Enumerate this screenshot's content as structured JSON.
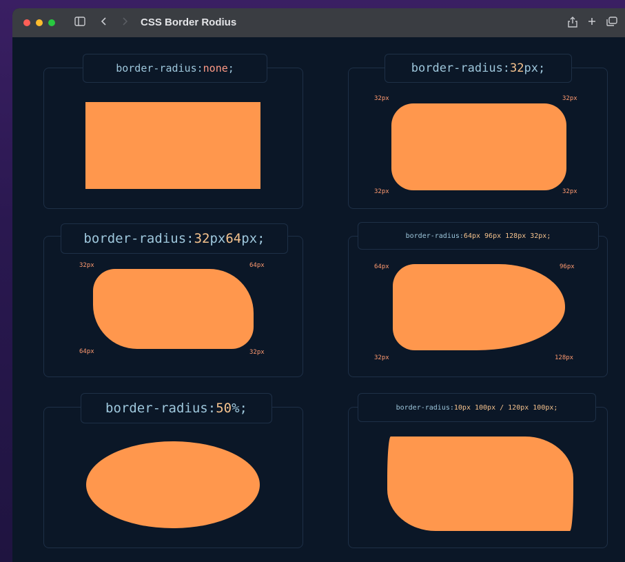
{
  "window": {
    "title": "CSS Border Rodius",
    "icons": [
      "sidebar-icon",
      "back-icon",
      "share-icon",
      "new-tab-icon",
      "tabs-icon"
    ],
    "traffic_colors": [
      "#ff5f57",
      "#febc2e",
      "#28c840"
    ]
  },
  "shape_color": "#ff974d",
  "cards": [
    {
      "prop": "border-radius:",
      "parts": [
        " ",
        "none",
        ";"
      ],
      "corners": []
    },
    {
      "prop": "border-radius:",
      "parts": [
        " ",
        "32",
        "px;"
      ],
      "corners": [
        "32px",
        "32px",
        "32px",
        "32px"
      ]
    },
    {
      "prop": "border-radius:",
      "parts": [
        " ",
        "32",
        "px ",
        "64",
        "px;"
      ],
      "corners": [
        "32px",
        "64px",
        "64px",
        "32px"
      ]
    },
    {
      "prop": "border-radius:",
      "value": " 64px 96px 128px 32px;",
      "corners": [
        "64px",
        "96px",
        "32px",
        "128px"
      ]
    },
    {
      "prop": "border-radius:",
      "parts": [
        " ",
        "50",
        "%;"
      ],
      "corners": []
    },
    {
      "prop": "border-radius:",
      "value": "10px 100px / 120px 100px;",
      "corners": []
    }
  ]
}
